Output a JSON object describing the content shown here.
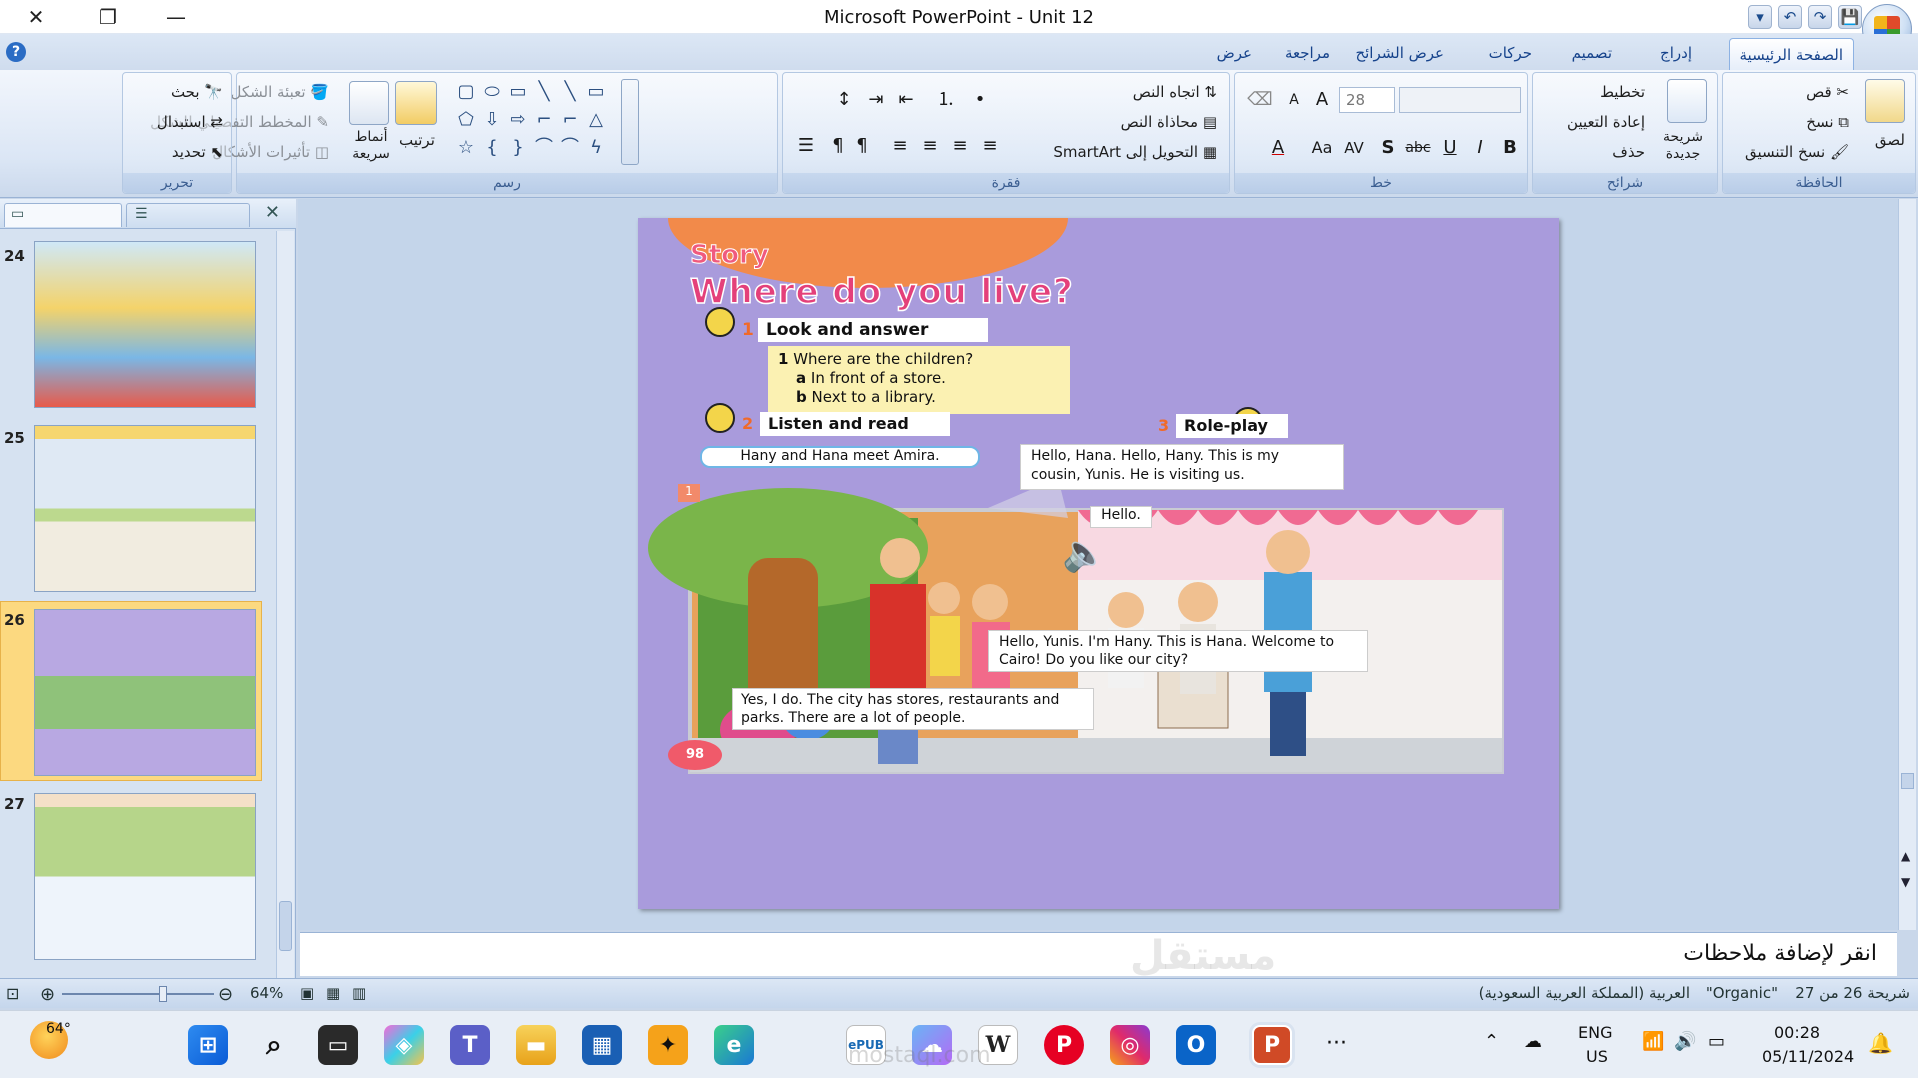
{
  "window": {
    "title": "Microsoft PowerPoint - Unit 12",
    "close": "✕",
    "restore": "❐",
    "minimize": "—"
  },
  "qat": {
    "undo": "↶",
    "redo": "↷",
    "save": "💾",
    "more": "▾"
  },
  "tabs": [
    {
      "label": "الصفحة الرئيسية"
    },
    {
      "label": "إدراج"
    },
    {
      "label": "تصميم"
    },
    {
      "label": "حركات"
    },
    {
      "label": "عرض الشرائح"
    },
    {
      "label": "مراجعة"
    },
    {
      "label": "عرض"
    }
  ],
  "ribbon": {
    "clipboard": {
      "group": "الحافظة",
      "paste": "لصق",
      "cut": "قص",
      "copy": "نسخ",
      "format_painter": "نسخ التنسيق"
    },
    "slides": {
      "group": "شرائح",
      "new_slide": "شريحة جديدة",
      "layout": "تخطيط",
      "reset": "إعادة التعيين",
      "delete": "حذف"
    },
    "font": {
      "group": "خط",
      "size": "28",
      "bold": "B",
      "italic": "I",
      "underline": "U",
      "strike": "abc",
      "shadow": "S",
      "spacing": "AV",
      "case": "Aa",
      "color": "A",
      "grow": "A",
      "shrink": "A"
    },
    "paragraph": {
      "group": "فقرة",
      "text_direction": "اتجاه النص",
      "align_text": "محاذاة النص",
      "smartart": "التحويل إلى SmartArt"
    },
    "drawing": {
      "group": "رسم",
      "arrange": "ترتيب",
      "quick_styles": "أنماط سريعة",
      "shape_fill": "تعبئة الشكل",
      "shape_outline": "المخطط التفصيلي للشكل",
      "shape_effects": "تأثيرات الأشكال"
    },
    "editing": {
      "group": "تحرير",
      "find": "بحث",
      "replace": "استبدال",
      "select": "تحديد"
    }
  },
  "slides_pane": {
    "thumbs": [
      {
        "num": "24"
      },
      {
        "num": "25"
      },
      {
        "num": "26"
      },
      {
        "num": "27"
      }
    ],
    "close": "✕"
  },
  "slide": {
    "story": "Story",
    "heading": "Where do you live?",
    "section1": "Look and answer",
    "section1_num": "1",
    "q_num": "1",
    "question": "Where are the children?",
    "a_label": "a",
    "answer_a": "In front of a store.",
    "b_label": "b",
    "answer_b": "Next to a library.",
    "section2_num": "2",
    "section2": "Listen and read",
    "section3_num": "3",
    "section3": "Role-play",
    "caption": "Hany and Hana meet Amira.",
    "frame_num": "1",
    "bubble1": "Hello, Hana. Hello, Hany. This is my cousin, Yunis. He is visiting us.",
    "bubble2": "Hello.",
    "bubble3": "Hello, Yunis. I'm Hany. This is Hana. Welcome to Cairo! Do you like our city?",
    "bubble4": "Yes, I do. The city has stores, restaurants and parks. There are a lot of people.",
    "page": "98"
  },
  "notes": {
    "placeholder": "انقر لإضافة ملاحظات"
  },
  "status": {
    "slide": "شريحة 26 من 27",
    "theme": "\"Organic\"",
    "language": "العربية (المملكة العربية السعودية)",
    "zoom": "64%",
    "zoom_level": 0.64
  },
  "taskbar": {
    "weather_temp": "64°",
    "lang1": "ENG",
    "lang2": "US",
    "time": "00:28",
    "date": "05/11/2024",
    "more": "···"
  },
  "watermark": {
    "text": "مستقل",
    "sub": "mostaql.com"
  },
  "colors": {
    "ribbon": "#dbe6f5",
    "slide_bg": "#a99bdc",
    "accent": "#15428b",
    "selected_thumb": "#fcd980"
  }
}
